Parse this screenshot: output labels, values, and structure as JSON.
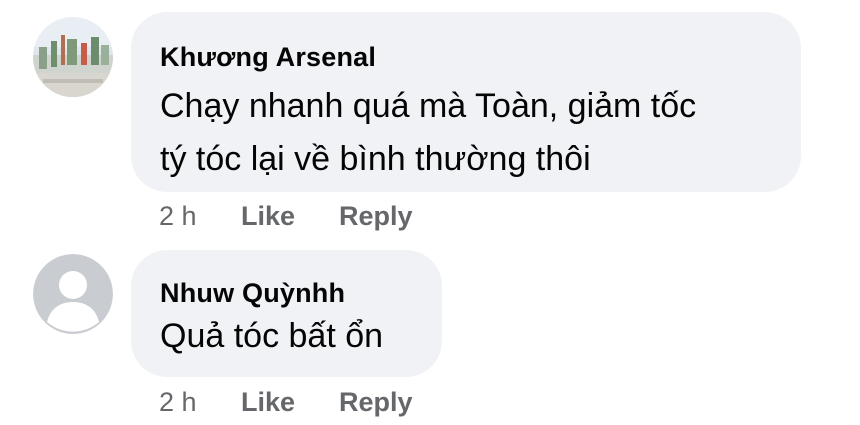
{
  "comments": [
    {
      "author": "Khương Arsenal",
      "lines": [
        "Chạy nhanh quá mà Toàn, giảm tốc",
        "tý tóc lại về bình thường thôi"
      ],
      "time": "2 h",
      "like_label": "Like",
      "reply_label": "Reply",
      "avatar_icon": "profile-photo"
    },
    {
      "author": "Nhuw Quỳnhh",
      "lines": [
        "Quả tóc bất ổn"
      ],
      "time": "2 h",
      "like_label": "Like",
      "reply_label": "Reply",
      "avatar_icon": "default-user-icon"
    }
  ],
  "colors": {
    "bubble": "#f0f2f5",
    "text": "#050505",
    "meta": "#65676b",
    "default_avatar_bg": "#c9ccd1"
  }
}
